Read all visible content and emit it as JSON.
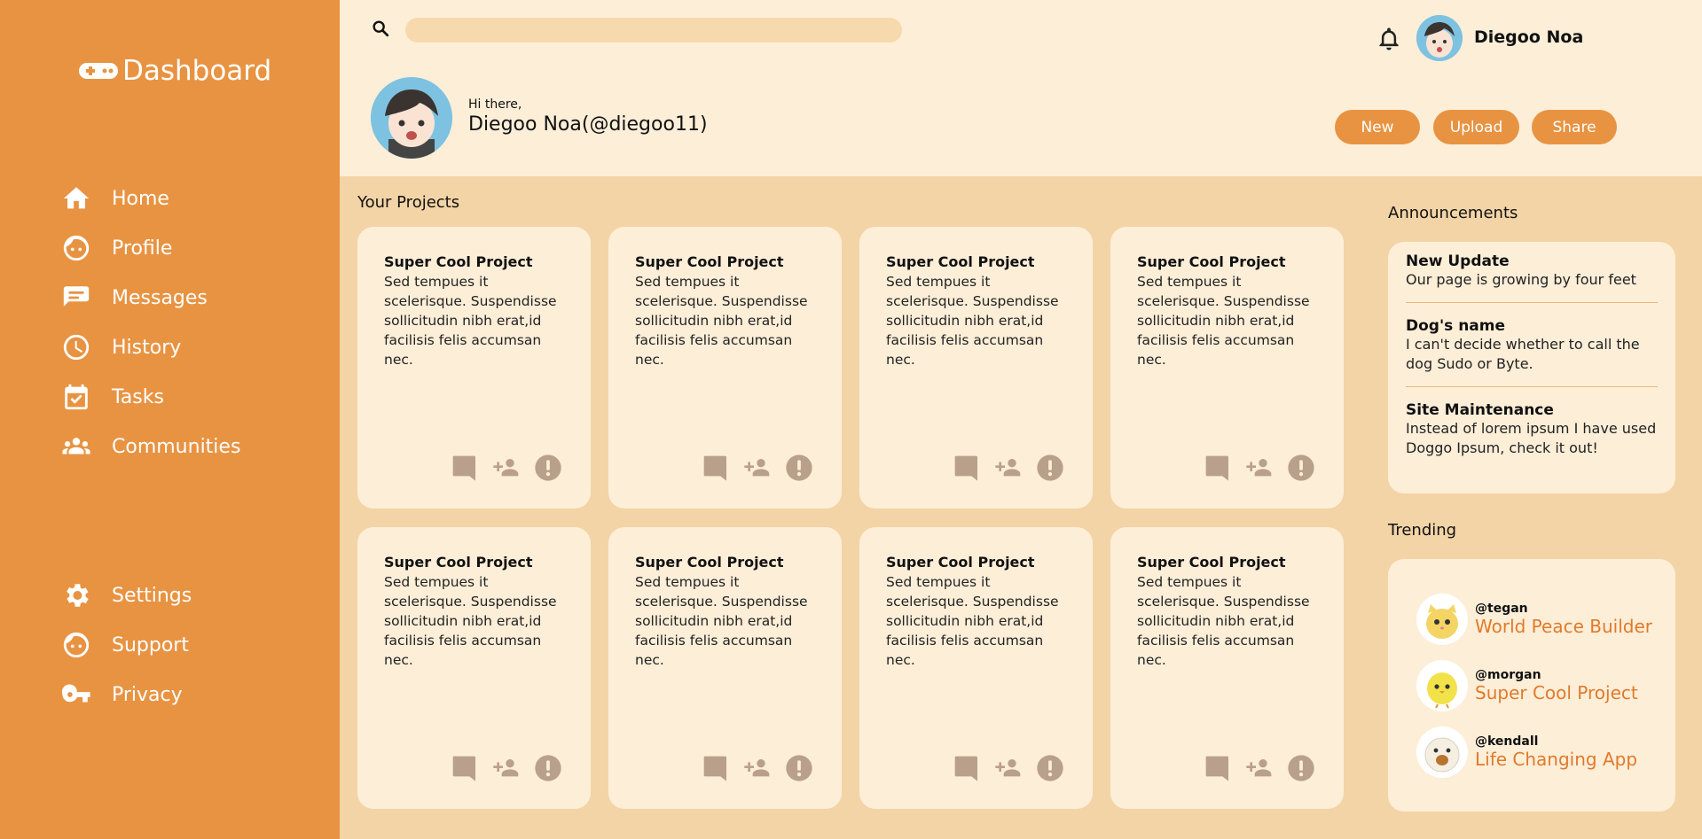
{
  "sidebar": {
    "brand": "Dashboard",
    "top_items": [
      {
        "label": "Home",
        "icon": "home-icon"
      },
      {
        "label": "Profile",
        "icon": "face-icon"
      },
      {
        "label": "Messages",
        "icon": "messages-icon"
      },
      {
        "label": "History",
        "icon": "clock-icon"
      },
      {
        "label": "Tasks",
        "icon": "calendar-check-icon"
      },
      {
        "label": "Communities",
        "icon": "group-icon"
      }
    ],
    "bottom_items": [
      {
        "label": "Settings",
        "icon": "gear-icon"
      },
      {
        "label": "Support",
        "icon": "face-icon"
      },
      {
        "label": "Privacy",
        "icon": "key-icon"
      }
    ]
  },
  "header": {
    "search": {
      "value": "",
      "placeholder": ""
    },
    "user_name": "Diegoo Noa",
    "greeting": "Hi there,",
    "full_name": "Diegoo Noa(@diegoo11)",
    "buttons": {
      "new": "New",
      "upload": "Upload",
      "share": "Share"
    }
  },
  "projects": {
    "title": "Your Projects",
    "cards": [
      {
        "title": "Super Cool Project",
        "description": "Sed tempues it scelerisque. Suspendisse sollicitudin nibh erat,id facilisis felis accumsan nec."
      },
      {
        "title": "Super Cool Project",
        "description": "Sed tempues it scelerisque. Suspendisse sollicitudin nibh erat,id facilisis felis accumsan nec."
      },
      {
        "title": "Super Cool Project",
        "description": "Sed tempues it scelerisque. Suspendisse sollicitudin nibh erat,id facilisis felis accumsan nec."
      },
      {
        "title": "Super Cool Project",
        "description": "Sed tempues it scelerisque. Suspendisse sollicitudin nibh erat,id facilisis felis accumsan nec."
      },
      {
        "title": "Super Cool Project",
        "description": "Sed tempues it scelerisque. Suspendisse sollicitudin nibh erat,id facilisis felis accumsan nec."
      },
      {
        "title": "Super Cool Project",
        "description": "Sed tempues it scelerisque. Suspendisse sollicitudin nibh erat,id facilisis felis accumsan nec."
      },
      {
        "title": "Super Cool Project",
        "description": "Sed tempues it scelerisque. Suspendisse sollicitudin nibh erat,id facilisis felis accumsan nec."
      },
      {
        "title": "Super Cool Project",
        "description": "Sed tempues it scelerisque. Suspendisse sollicitudin nibh erat,id facilisis felis accumsan nec."
      }
    ]
  },
  "announcements": {
    "title": "Announcements",
    "items": [
      {
        "title": "New Update",
        "text": "Our page is growing by four feet"
      },
      {
        "title": "Dog's name",
        "text": "I can't decide whether to call the dog Sudo or Byte."
      },
      {
        "title": "Site Maintenance",
        "text": "Instead of lorem ipsum I have used Doggo Ipsum, check it out!"
      }
    ]
  },
  "trending": {
    "title": "Trending",
    "items": [
      {
        "handle": "@tegan",
        "project": "World Peace Builder"
      },
      {
        "handle": "@morgan",
        "project": "Super Cool Project"
      },
      {
        "handle": "@kendall",
        "project": "Life Changing App"
      }
    ]
  },
  "colors": {
    "sidebar": "#e89342",
    "header_bg": "#fdeed8",
    "main_bg": "#f3d4a6",
    "card_bg": "#fdeed8",
    "accent_link": "#e07a2a",
    "action_icon": "#b9a08a"
  }
}
